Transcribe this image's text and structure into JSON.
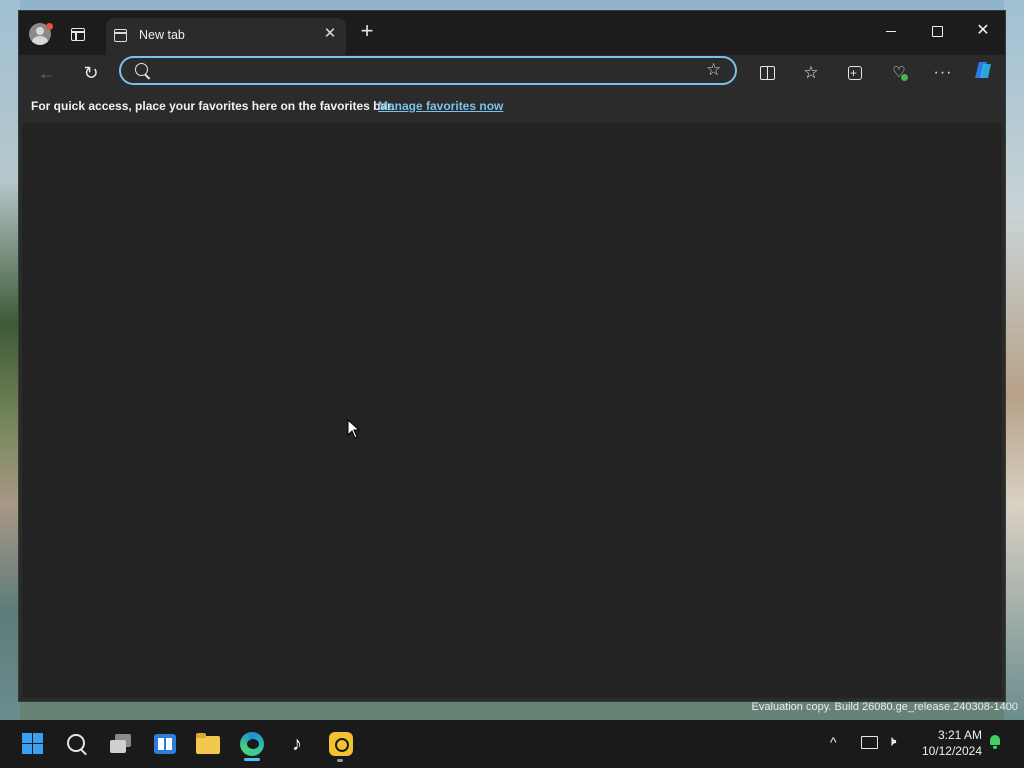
{
  "browser": {
    "tab_title": "New tab",
    "tab_close": "✕",
    "new_tab": "+",
    "window_close": "✕",
    "address_placeholder": "",
    "address_value": "",
    "back_glyph": "←",
    "refresh_glyph": "↻",
    "star_glyph": "☆",
    "favorites_glyph": "☆",
    "health_glyph": "♡",
    "more_glyph": "···",
    "favorites_bar": {
      "message": "For quick access, place your favorites here on the favorites bar.",
      "link_label": "Manage favorites now"
    },
    "accent_color": "#7cc1e8"
  },
  "desktop": {
    "watermark": "Evaluation copy. Build 26080.ge_release.240308-1400"
  },
  "taskbar": {
    "apps": [
      {
        "name": "start",
        "icon": "windows-logo-icon"
      },
      {
        "name": "search",
        "icon": "search-icon"
      },
      {
        "name": "task-view",
        "icon": "task-view-icon"
      },
      {
        "name": "widgets",
        "icon": "widgets-icon"
      },
      {
        "name": "file-explorer",
        "icon": "folder-icon"
      },
      {
        "name": "edge",
        "icon": "edge-icon",
        "active": true
      },
      {
        "name": "tiktok",
        "icon": "tiktok-icon"
      },
      {
        "name": "app",
        "icon": "yellow-app-icon"
      }
    ],
    "tray_chevron": "^",
    "clock_time": "3:21 AM",
    "clock_date": "10/12/2024"
  }
}
